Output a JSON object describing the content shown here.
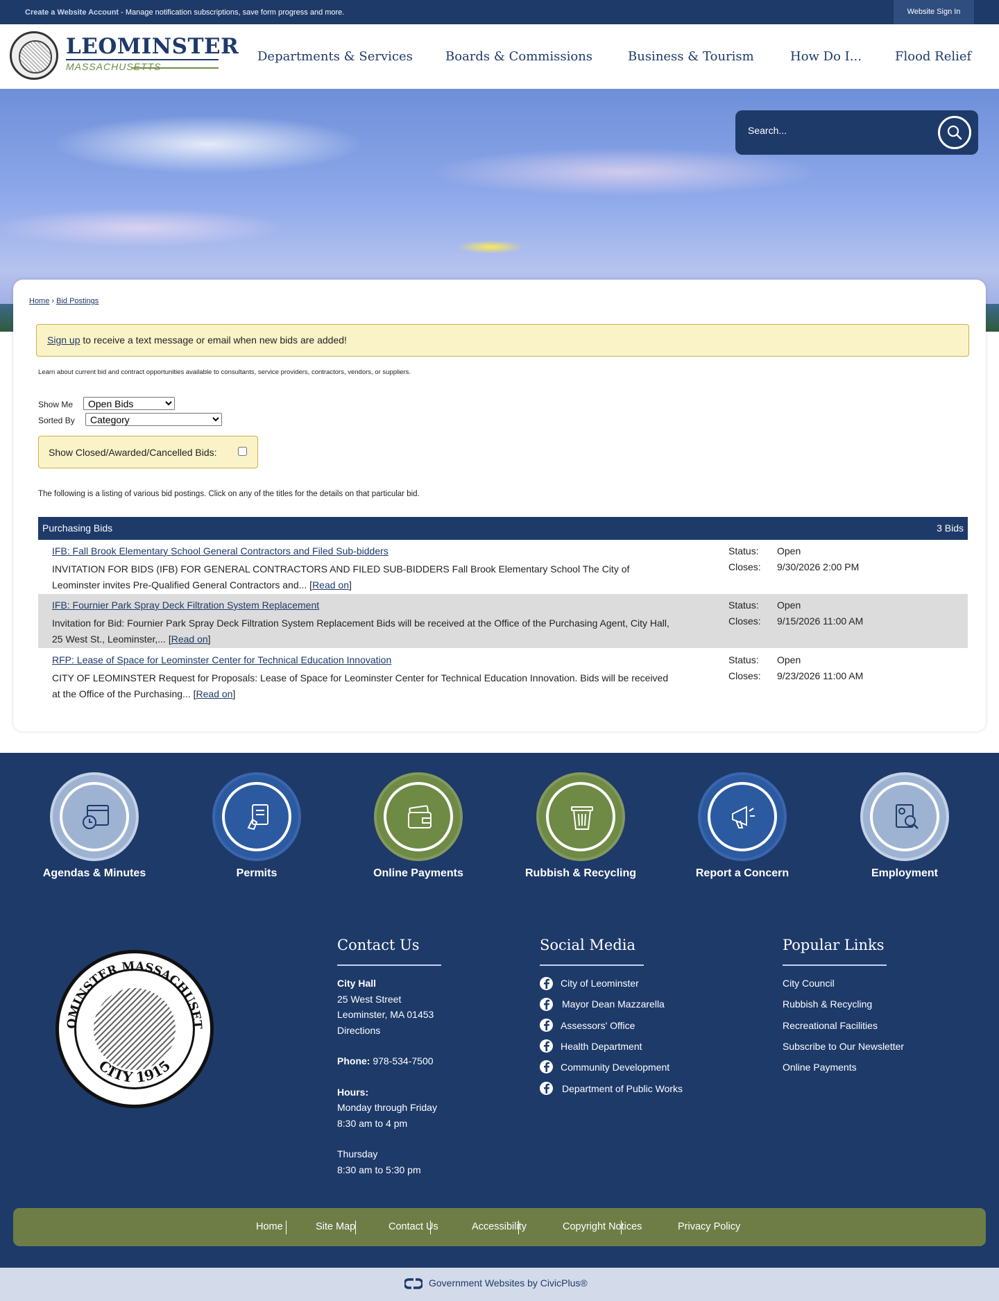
{
  "topbar": {
    "create_account": "Create a Website Account",
    "create_account_desc": " - Manage notification subscriptions, save form progress and more.",
    "sign_in": "Website Sign In"
  },
  "logo": {
    "name": "LEOMINSTER",
    "sub": "MASSACHUSETTS"
  },
  "nav": [
    "Departments & Services",
    "Boards & Commissions",
    "Business & Tourism",
    "How Do I...",
    "Flood Relief"
  ],
  "search": {
    "placeholder": "Search..."
  },
  "breadcrumb": {
    "home": "Home",
    "sep": "›",
    "current": "Bid Postings"
  },
  "alert": {
    "link": "Sign up",
    "text": " to receive a text message or email when new bids are added!"
  },
  "intro": "Learn about current bid and contract opportunities available to consultants, service providers, contractors, vendors, or suppliers.",
  "filters": {
    "show_me_label": "Show Me",
    "show_me_value": "Open Bids",
    "sorted_by_label": "Sorted By",
    "sorted_by_value": "Category",
    "closed_label": "Show Closed/Awarded/Cancelled Bids:"
  },
  "list_intro": "The following is a listing of various bid postings. Click on any of the titles for the details on that particular bid.",
  "bid_section": {
    "title": "Purchasing Bids",
    "count": "3 Bids"
  },
  "bid_labels": {
    "status": "Status:",
    "closes": "Closes:",
    "read_on": "Read on"
  },
  "bids": [
    {
      "title": "IFB: Fall Brook Elementary School General Contractors and Filed Sub-bidders",
      "desc_line1": "INVITATION FOR BIDS (IFB) FOR GENERAL CONTRACTORS AND FILED SUB-BIDDERS Fall Brook Elementary School The City of",
      "desc_line2": "Leominster invites Pre-Qualified General Contractors and... ",
      "status": "Open",
      "closes": "9/30/2026 2:00 PM"
    },
    {
      "title": "IFB: Fournier Park Spray Deck Filtration System Replacement",
      "desc_line1": "Invitation for Bid: Fournier Park Spray Deck Filtration System Replacement Bids will be received at the Office of the Purchasing Agent, City Hall,",
      "desc_line2": "25 West St., Leominster,... ",
      "status": "Open",
      "closes": "9/15/2026 11:00 AM"
    },
    {
      "title": "RFP: Lease of Space for Leominster Center for Technical Education Innovation",
      "desc_line1": "CITY OF LEOMINSTER Request for Proposals: Lease of Space for Leominster Center for Technical Education Innovation. Bids will be received",
      "desc_line2": "at the Office of the Purchasing... ",
      "status": "Open",
      "closes": "9/23/2026 11:00 AM"
    }
  ],
  "quick_links": [
    {
      "label": "Agendas & Minutes",
      "icon": "calendar-clock-icon",
      "color": "#9db3d1"
    },
    {
      "label": "Permits",
      "icon": "document-hand-icon",
      "color": "#2c5aa0"
    },
    {
      "label": "Online Payments",
      "icon": "wallet-icon",
      "color": "#6e8a45"
    },
    {
      "label": "Rubbish & Recycling",
      "icon": "trash-icon",
      "color": "#6e8a45"
    },
    {
      "label": "Report a Concern",
      "icon": "megaphone-icon",
      "color": "#2c5aa0"
    },
    {
      "label": "Employment",
      "icon": "resume-search-icon",
      "color": "#9db3d1"
    }
  ],
  "seal": {
    "top": "LEOMINSTER MASSACHUSETTS",
    "bottom": "CITY 1915"
  },
  "contact": {
    "heading": "Contact Us",
    "place": "City Hall",
    "street": "25 West Street",
    "city": "Leominster, MA 01453",
    "directions": "Directions",
    "phone_label": "Phone:",
    "phone": " 978-534-7500",
    "hours_label": "Hours:",
    "hours1": "Monday through Friday",
    "hours2": "8:30 am to 4 pm",
    "hours3": "Thursday",
    "hours4": "8:30 am to 5:30 pm"
  },
  "social": {
    "heading": "Social Media",
    "items": [
      "City of Leominster",
      "Mayor Dean Mazzarella",
      "Assessors' Office",
      "Health Department",
      "Community Development",
      "Department of Public Works"
    ]
  },
  "popular": {
    "heading": "Popular Links",
    "items": [
      "City Council",
      "Rubbish & Recycling",
      "Recreational Facilities",
      "Subscribe to Our Newsletter",
      "Online Payments"
    ]
  },
  "bottom_links": [
    "Home",
    "Site Map",
    "Contact Us",
    "Accessibility",
    "Copyright Notices",
    "Privacy Policy"
  ],
  "civicplus": "Government Websites by CivicPlus®",
  "colors": {
    "navy": "#1d3a69",
    "olive": "#6e7d46",
    "alert": "#fbf3c8"
  }
}
